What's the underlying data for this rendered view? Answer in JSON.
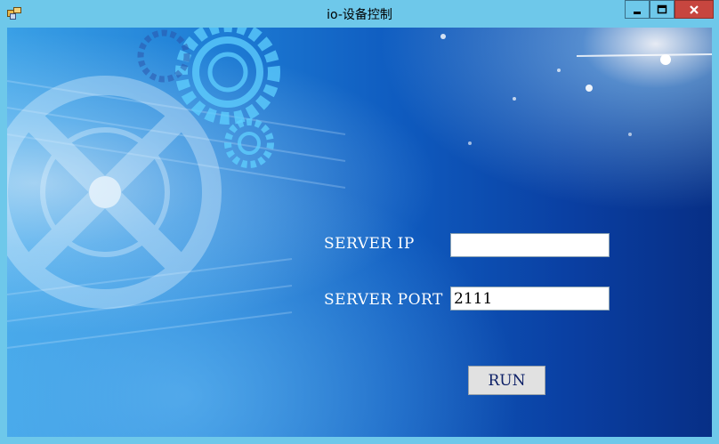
{
  "window": {
    "title": "io-设备控制",
    "controls": {
      "minimize_icon": "minimize-icon",
      "maximize_icon": "maximize-icon",
      "close_icon": "close-icon"
    }
  },
  "form": {
    "server_ip_label": "SERVER IP",
    "server_ip_value": "",
    "server_port_label": "SERVER PORT",
    "server_port_value": "2111",
    "run_label": "RUN"
  },
  "colors": {
    "titlebar": "#6ec8ea",
    "close_button": "#c7463f",
    "background_dark": "#072f86",
    "background_light": "#3aa0e6"
  }
}
